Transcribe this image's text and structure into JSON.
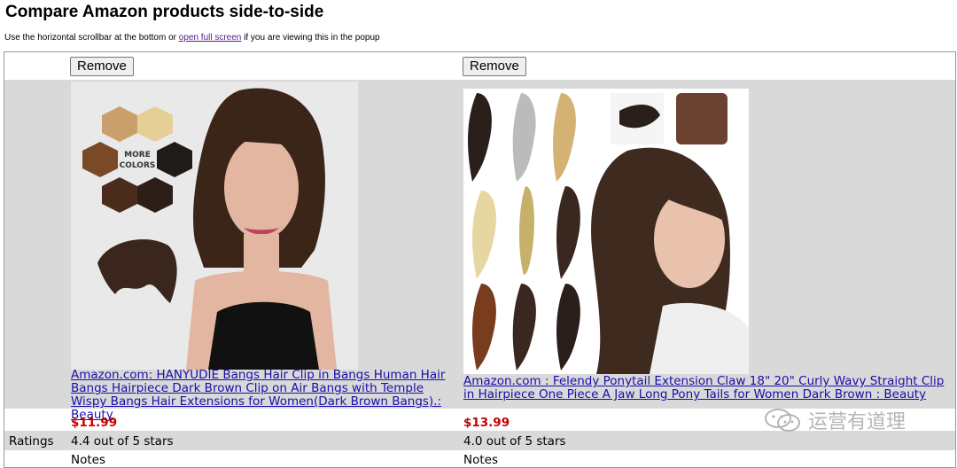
{
  "page": {
    "title": "Compare Amazon products side-to-side",
    "intro_before": "Use the horizontal scrollbar at the bottom or ",
    "intro_link": "open full screen",
    "intro_after": " if you are viewing this in the popup"
  },
  "table": {
    "ratings_label": "Ratings",
    "products": [
      {
        "remove_label": "Remove",
        "image_alt": "hair bangs clip product photo",
        "link_text": "Amazon.com: HANYUDIE Bangs Hair Clip in Bangs Human Hair Bangs Hairpiece Dark Brown Clip on Air Bangs with Temple Wispy Bangs Hair Extensions for Women(Dark Brown Bangs).: Beauty",
        "price": "$11.99",
        "rating": "4.4 out of 5 stars",
        "notes_label": "Notes",
        "swatch_text": "MORE COLORS"
      },
      {
        "remove_label": "Remove",
        "image_alt": "ponytail extension product photo",
        "link_text": "Amazon.com : Felendy Ponytail Extension Claw 18\" 20\" Curly Wavy Straight Clip in Hairpiece One Piece A Jaw Long Pony Tails for Women Dark Brown : Beauty",
        "price": "$13.99",
        "rating": "4.0 out of 5 stars",
        "notes_label": "Notes"
      }
    ]
  },
  "watermark": {
    "text": "运营有道理"
  },
  "colors": {
    "price": "#c40000",
    "link": "#1a0dab",
    "row_band": "#d9d9d9"
  }
}
